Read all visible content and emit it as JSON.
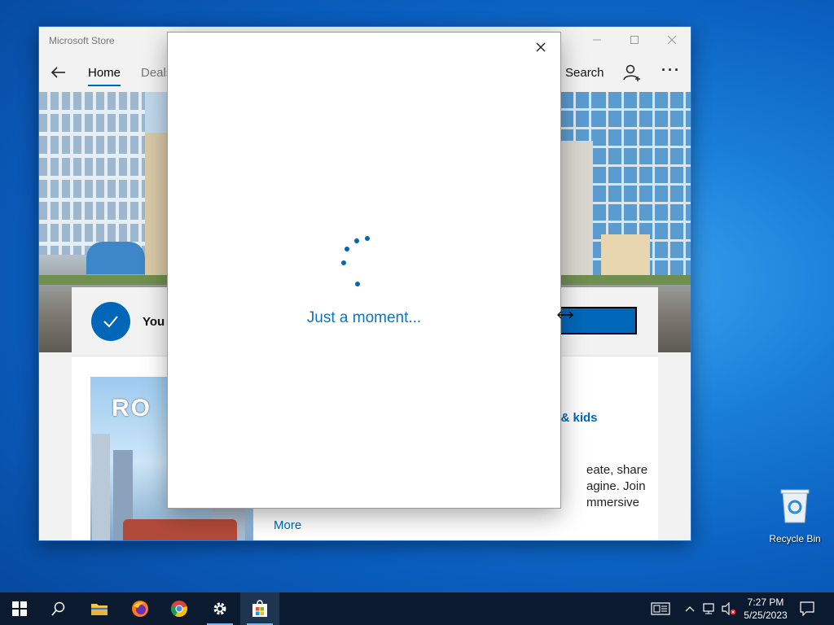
{
  "store": {
    "title": "Microsoft Store",
    "nav": {
      "home": "Home",
      "deals": "Deals",
      "search": "Search"
    },
    "install_bar": {
      "message": "You c"
    },
    "content": {
      "game_logo": "RO",
      "tag": "y & kids",
      "desc_lines": [
        "eate, share",
        "agine. Join",
        "mmersive"
      ],
      "more": "More"
    }
  },
  "dialog": {
    "loading_text": "Just a moment..."
  },
  "desktop": {
    "recycle_bin": "Recycle Bin"
  },
  "taskbar": {
    "time": "7:27 PM",
    "date": "5/25/2023"
  },
  "colors": {
    "accent": "#0067b8",
    "taskbar": "#0b1a2e"
  }
}
